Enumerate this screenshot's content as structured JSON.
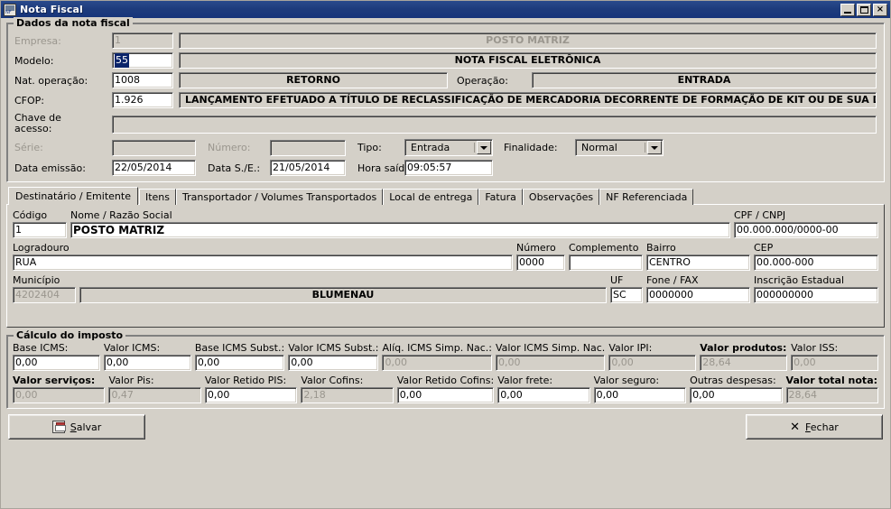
{
  "window": {
    "title": "Nota Fiscal",
    "icon": "nota-fiscal-icon",
    "minimize": "_",
    "maximize": "□",
    "close": "×"
  },
  "header_group": {
    "legend": "Dados da nota fiscal",
    "empresa": {
      "label": "Empresa:",
      "code": "1",
      "name": "POSTO MATRIZ"
    },
    "modelo": {
      "label": "Modelo:",
      "code": "55",
      "name": "NOTA FISCAL ELETRÔNICA"
    },
    "nat_operacao": {
      "label": "Nat. operação:",
      "code": "1008",
      "name": "RETORNO"
    },
    "operacao": {
      "label": "Operação:",
      "value": "ENTRADA"
    },
    "cfop": {
      "label": "CFOP:",
      "code": "1.926",
      "name": "LANÇAMENTO EFETUADO A TÍTULO DE RECLASSIFICAÇÃO DE MERCADORIA DECORRENTE DE FORMAÇÃO DE KIT OU DE SUA DESAGREGAÇ"
    },
    "chave_acesso": {
      "label_line1": "Chave de",
      "label_line2": "acesso:",
      "value": ""
    },
    "serie": {
      "label": "Série:",
      "value": ""
    },
    "numero": {
      "label": "Número:",
      "value": ""
    },
    "tipo": {
      "label": "Tipo:",
      "value": "Entrada"
    },
    "finalidade": {
      "label": "Finalidade:",
      "value": "Normal"
    },
    "data_emissao": {
      "label": "Data emissão:",
      "value": "22/05/2014"
    },
    "data_se": {
      "label": "Data S./E.:",
      "value": "21/05/2014"
    },
    "hora_saida": {
      "label": "Hora saída:",
      "value": "09:05:57"
    }
  },
  "tabs": [
    {
      "label": "Destinatário / Emitente",
      "active": true
    },
    {
      "label": "Itens",
      "active": false
    },
    {
      "label": "Transportador / Volumes Transportados",
      "active": false
    },
    {
      "label": "Local de entrega",
      "active": false
    },
    {
      "label": "Fatura",
      "active": false
    },
    {
      "label": "Observações",
      "active": false
    },
    {
      "label": "NF Referenciada",
      "active": false
    }
  ],
  "destinatario": {
    "codigo": {
      "label": "Código",
      "value": "1"
    },
    "nome": {
      "label": "Nome / Razão Social",
      "value": "POSTO MATRIZ"
    },
    "cpf_cnpj": {
      "label": "CPF / CNPJ",
      "value": "00.000.000/0000-00"
    },
    "logradouro": {
      "label": "Logradouro",
      "value": "RUA"
    },
    "numero": {
      "label": "Número",
      "value": "0000"
    },
    "complemento": {
      "label": "Complemento",
      "value": ""
    },
    "bairro": {
      "label": "Bairro",
      "value": "CENTRO"
    },
    "cep": {
      "label": "CEP",
      "value": "00.000-000"
    },
    "municipio": {
      "label": "Município",
      "code": "4202404",
      "name": "BLUMENAU"
    },
    "uf": {
      "label": "UF",
      "value": "SC"
    },
    "fone_fax": {
      "label": "Fone / FAX",
      "value": "0000000"
    },
    "inscricao_estadual": {
      "label": "Inscrição Estadual",
      "value": "000000000"
    }
  },
  "imposto": {
    "legend": "Cálculo do imposto",
    "row1": [
      {
        "label": "Base ICMS:",
        "value": "0,00",
        "readonly": false,
        "bold": false
      },
      {
        "label": "Valor ICMS:",
        "value": "0,00",
        "readonly": false,
        "bold": false
      },
      {
        "label": "Base ICMS Subst.:",
        "value": "0,00",
        "readonly": false,
        "bold": false
      },
      {
        "label": "Valor ICMS Subst.:",
        "value": "0,00",
        "readonly": false,
        "bold": false
      },
      {
        "label": "Alíq. ICMS Simp. Nac.:",
        "value": "0,00",
        "readonly": true,
        "bold": false
      },
      {
        "label": "Valor ICMS Simp. Nac.",
        "value": "0,00",
        "readonly": true,
        "bold": false
      },
      {
        "label": "Valor IPI:",
        "value": "0,00",
        "readonly": true,
        "bold": false
      },
      {
        "label": "Valor produtos:",
        "value": "28,64",
        "readonly": true,
        "bold": true
      },
      {
        "label": "Valor ISS:",
        "value": "0,00",
        "readonly": true,
        "bold": false
      }
    ],
    "row2": [
      {
        "label": "Valor serviços:",
        "value": "0,00",
        "readonly": true,
        "bold": true
      },
      {
        "label": "Valor Pis:",
        "value": "0,47",
        "readonly": true,
        "bold": false
      },
      {
        "label": "Valor Retido PIS:",
        "value": "0,00",
        "readonly": false,
        "bold": false
      },
      {
        "label": "Valor Cofins:",
        "value": "2,18",
        "readonly": true,
        "bold": false
      },
      {
        "label": "Valor Retido Cofins:",
        "value": "0,00",
        "readonly": false,
        "bold": false
      },
      {
        "label": "Valor frete:",
        "value": "0,00",
        "readonly": false,
        "bold": false
      },
      {
        "label": "Valor seguro:",
        "value": "0,00",
        "readonly": false,
        "bold": false
      },
      {
        "label": "Outras despesas:",
        "value": "0,00",
        "readonly": false,
        "bold": false
      },
      {
        "label": "Valor total nota:",
        "value": "28,64",
        "readonly": true,
        "bold": true
      }
    ]
  },
  "footer": {
    "save": {
      "label": "Salvar",
      "accel": "S",
      "icon": "floppy-disk-icon"
    },
    "close": {
      "label": "Fechar",
      "accel": "F",
      "icon": "x-icon"
    }
  }
}
